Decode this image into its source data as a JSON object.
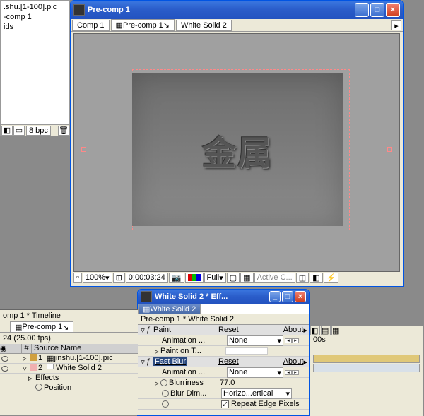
{
  "project": {
    "items": [
      ".shu.[1-100].pic",
      "-comp 1",
      "ids"
    ],
    "bpc": "8 bpc"
  },
  "preview": {
    "title": "Pre-comp 1",
    "tabs": [
      "Comp 1",
      "Pre-comp 1",
      "White Solid 2"
    ],
    "content_text": "金属",
    "zoom": "100%",
    "timecode": "0:00:03:24",
    "res": "Full",
    "active": "Active C..."
  },
  "effects": {
    "title": "White Solid 2 * Eff...",
    "tab": "White Solid 2",
    "breadcrumb": "Pre-comp 1 * White Solid 2",
    "paint": {
      "name": "Paint",
      "reset": "Reset",
      "about": "About",
      "anim_label": "Animation ...",
      "anim_val": "None",
      "paint_on": "Paint on T..."
    },
    "blur": {
      "name": "Fast Blur",
      "reset": "Reset",
      "about": "About",
      "anim_label": "Animation ...",
      "anim_val": "None",
      "blurriness_label": "Blurriness",
      "blurriness": "77.0",
      "dim_label": "Blur Dim...",
      "dim_val": "Horizo...ertical",
      "repeat": "Repeat Edge Pixels"
    }
  },
  "timeline": {
    "title": "omp 1 * Timeline",
    "tab": "Pre-comp 1",
    "time_info": "24 (25.00 fps)",
    "header_num": "#",
    "header_source": "Source Name",
    "ruler_tick": "00s",
    "layers": [
      {
        "num": "1",
        "name": "jinshu.[1-100].pic",
        "color": "#d0a040"
      },
      {
        "num": "2",
        "name": "White Solid 2",
        "color": "#f0b0b0"
      }
    ],
    "effects_label": "Effects",
    "position_label": "Position"
  }
}
